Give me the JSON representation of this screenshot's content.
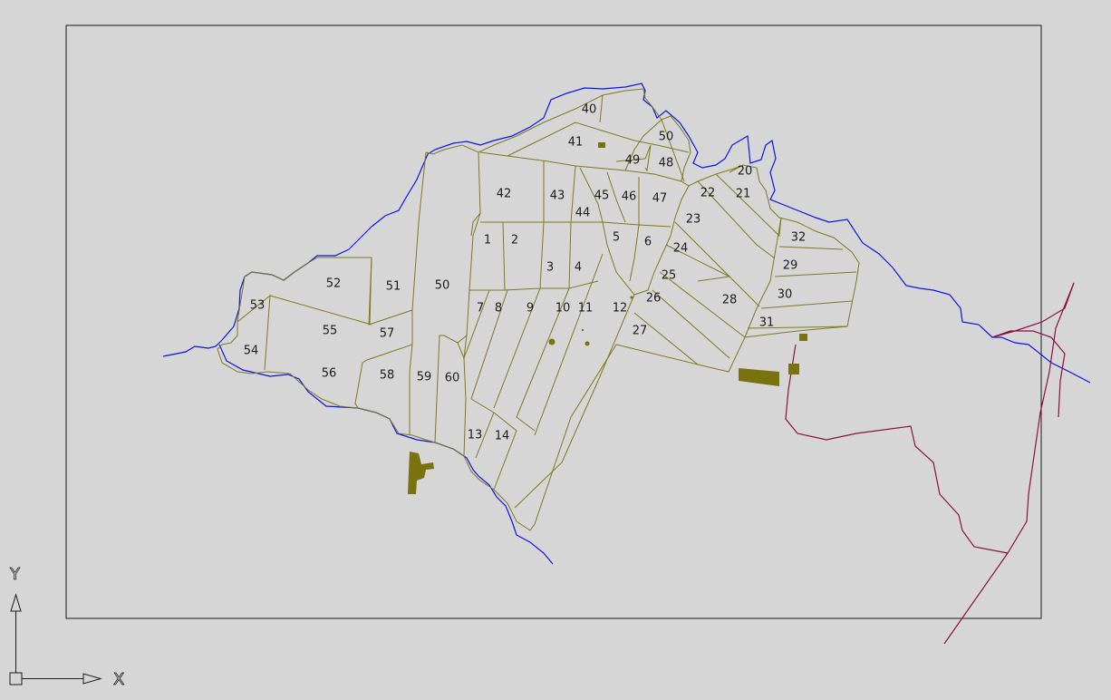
{
  "map": {
    "colors": {
      "background": "#d6d6d6",
      "frame": "#1a1a1a",
      "parcel_line": "#7d7a1f",
      "parcel_fill": "#7a720e",
      "water_line": "#0a14e6",
      "road_line": "#8a1040",
      "text": "#1a1a1a"
    },
    "parcel_labels": [
      "1",
      "2",
      "3",
      "4",
      "5",
      "6",
      "7",
      "8",
      "9",
      "10",
      "11",
      "12",
      "13",
      "14",
      "20",
      "21",
      "22",
      "23",
      "24",
      "25",
      "26",
      "27",
      "28",
      "29",
      "30",
      "31",
      "32",
      "40",
      "41",
      "42",
      "43",
      "44",
      "45",
      "46",
      "47",
      "48",
      "49",
      "50",
      "50",
      "51",
      "52",
      "53",
      "54",
      "55",
      "56",
      "57",
      "58",
      "59",
      "60"
    ]
  },
  "ucs": {
    "y_label": "Y",
    "x_label": "X"
  }
}
